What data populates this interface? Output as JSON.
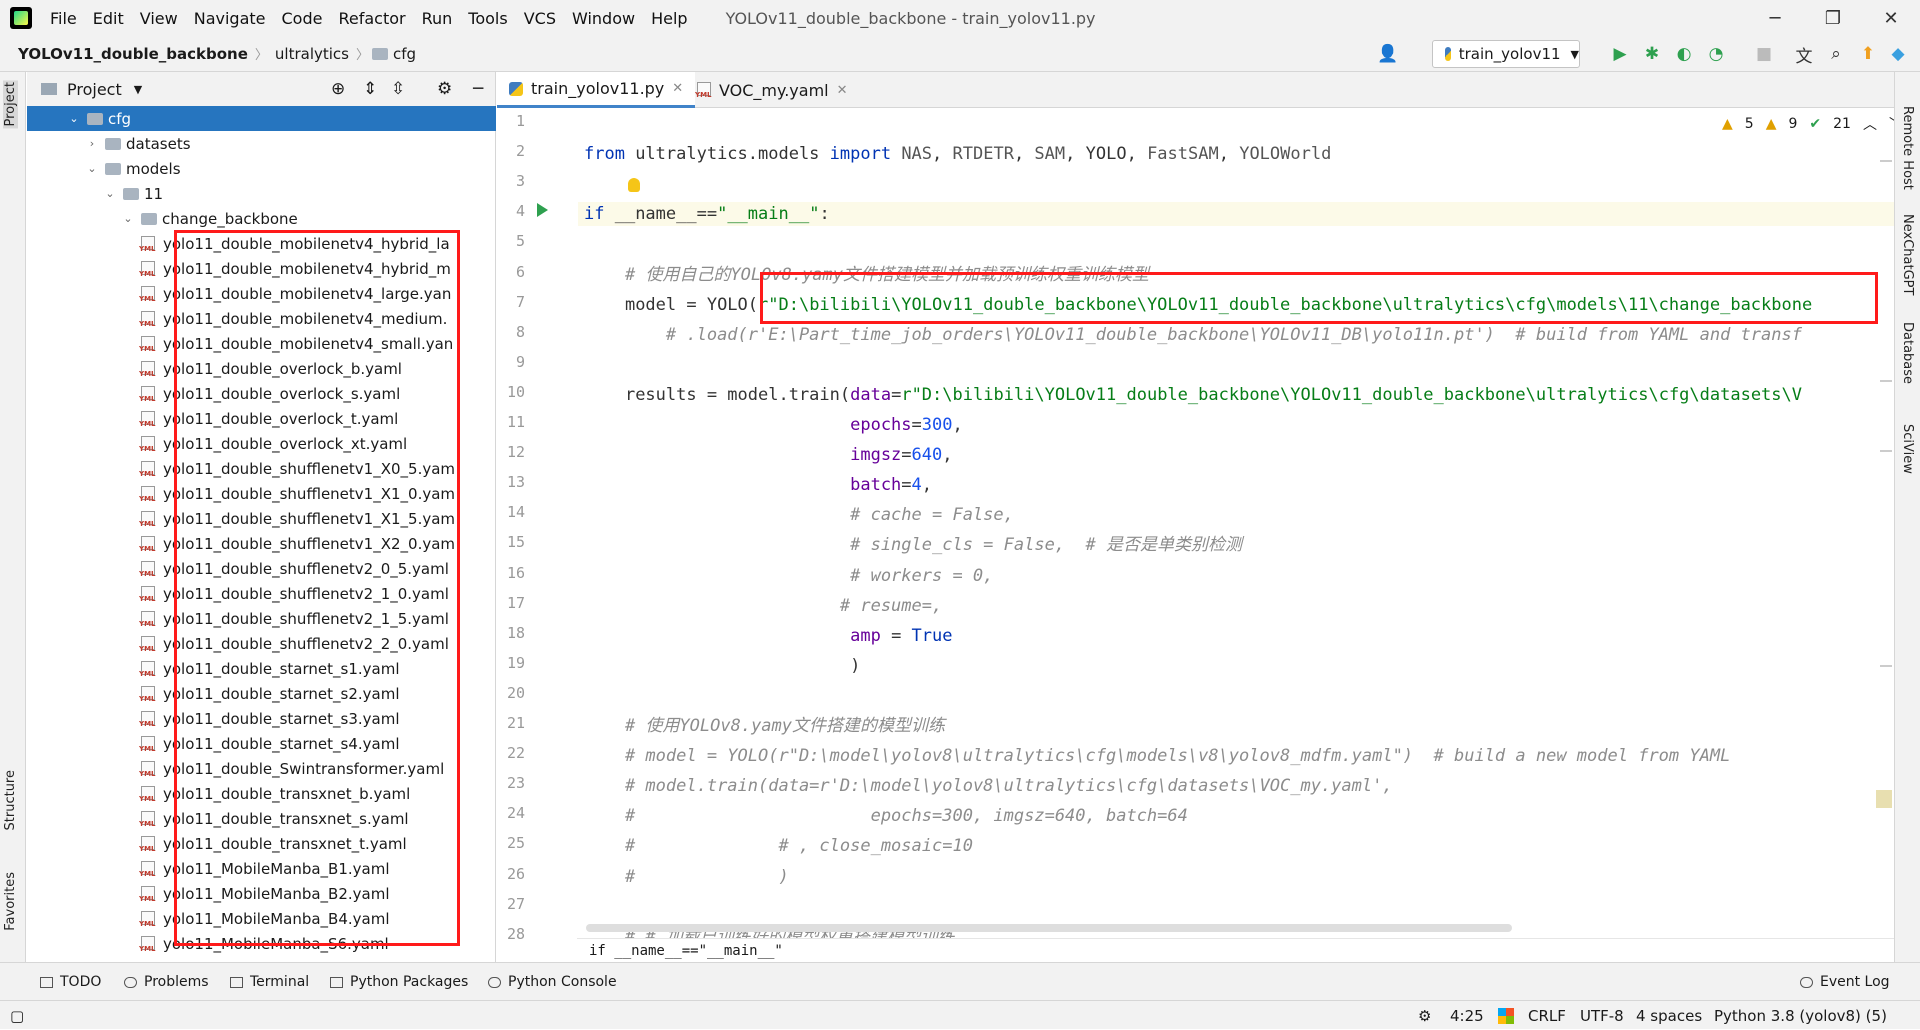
{
  "menubar": {
    "items": [
      "File",
      "Edit",
      "View",
      "Navigate",
      "Code",
      "Refactor",
      "Run",
      "Tools",
      "VCS",
      "Window",
      "Help"
    ],
    "title": "YOLOv11_double_backbone - train_yolov11.py"
  },
  "navbar": {
    "breadcrumb": [
      "YOLOv11_double_backbone",
      "ultralytics",
      "cfg"
    ],
    "run_config": "train_yolov11"
  },
  "project_panel": {
    "title": "Project",
    "tree": [
      {
        "label": "cfg",
        "level": 1,
        "expanded": true,
        "type": "folder",
        "selected": true
      },
      {
        "label": "datasets",
        "level": 2,
        "expanded": false,
        "type": "folder"
      },
      {
        "label": "models",
        "level": 2,
        "expanded": true,
        "type": "folder"
      },
      {
        "label": "11",
        "level": 3,
        "expanded": true,
        "type": "folder"
      },
      {
        "label": "change_backbone",
        "level": 4,
        "expanded": true,
        "type": "folder"
      },
      {
        "label": "yolo11_double_mobilenetv4_hybrid_la",
        "level": 5,
        "type": "yml"
      },
      {
        "label": "yolo11_double_mobilenetv4_hybrid_m",
        "level": 5,
        "type": "yml"
      },
      {
        "label": "yolo11_double_mobilenetv4_large.yan",
        "level": 5,
        "type": "yml"
      },
      {
        "label": "yolo11_double_mobilenetv4_medium.",
        "level": 5,
        "type": "yml"
      },
      {
        "label": "yolo11_double_mobilenetv4_small.yan",
        "level": 5,
        "type": "yml"
      },
      {
        "label": "yolo11_double_overlock_b.yaml",
        "level": 5,
        "type": "yml"
      },
      {
        "label": "yolo11_double_overlock_s.yaml",
        "level": 5,
        "type": "yml"
      },
      {
        "label": "yolo11_double_overlock_t.yaml",
        "level": 5,
        "type": "yml"
      },
      {
        "label": "yolo11_double_overlock_xt.yaml",
        "level": 5,
        "type": "yml"
      },
      {
        "label": "yolo11_double_shufflenetv1_X0_5.yam",
        "level": 5,
        "type": "yml"
      },
      {
        "label": "yolo11_double_shufflenetv1_X1_0.yam",
        "level": 5,
        "type": "yml"
      },
      {
        "label": "yolo11_double_shufflenetv1_X1_5.yam",
        "level": 5,
        "type": "yml"
      },
      {
        "label": "yolo11_double_shufflenetv1_X2_0.yam",
        "level": 5,
        "type": "yml"
      },
      {
        "label": "yolo11_double_shufflenetv2_0_5.yaml",
        "level": 5,
        "type": "yml"
      },
      {
        "label": "yolo11_double_shufflenetv2_1_0.yaml",
        "level": 5,
        "type": "yml"
      },
      {
        "label": "yolo11_double_shufflenetv2_1_5.yaml",
        "level": 5,
        "type": "yml"
      },
      {
        "label": "yolo11_double_shufflenetv2_2_0.yaml",
        "level": 5,
        "type": "yml"
      },
      {
        "label": "yolo11_double_starnet_s1.yaml",
        "level": 5,
        "type": "yml"
      },
      {
        "label": "yolo11_double_starnet_s2.yaml",
        "level": 5,
        "type": "yml"
      },
      {
        "label": "yolo11_double_starnet_s3.yaml",
        "level": 5,
        "type": "yml"
      },
      {
        "label": "yolo11_double_starnet_s4.yaml",
        "level": 5,
        "type": "yml"
      },
      {
        "label": "yolo11_double_Swintransformer.yaml",
        "level": 5,
        "type": "yml"
      },
      {
        "label": "yolo11_double_transxnet_b.yaml",
        "level": 5,
        "type": "yml"
      },
      {
        "label": "yolo11_double_transxnet_s.yaml",
        "level": 5,
        "type": "yml"
      },
      {
        "label": "yolo11_double_transxnet_t.yaml",
        "level": 5,
        "type": "yml"
      },
      {
        "label": "yolo11_MobileManba_B1.yaml",
        "level": 5,
        "type": "yml"
      },
      {
        "label": "yolo11_MobileManba_B2.yaml",
        "level": 5,
        "type": "yml"
      },
      {
        "label": "yolo11_MobileManba_B4.yaml",
        "level": 5,
        "type": "yml"
      },
      {
        "label": "yolo11_MobileManba_S6.yaml",
        "level": 5,
        "type": "yml"
      }
    ]
  },
  "tabs": [
    {
      "label": "train_yolov11.py",
      "active": true,
      "icon": "python-file-icon"
    },
    {
      "label": "VOC_my.yaml",
      "active": false,
      "icon": "yaml-file-icon"
    }
  ],
  "inspections": {
    "warnings": "5",
    "weak_warnings": "9",
    "typos": "21"
  },
  "editor": {
    "line_numbers": [
      "1",
      "2",
      "3",
      "4",
      "5",
      "6",
      "7",
      "8",
      "9",
      "10",
      "11",
      "12",
      "13",
      "14",
      "15",
      "16",
      "17",
      "18",
      "19",
      "20",
      "21",
      "22",
      "23",
      "24",
      "25",
      "26",
      "27",
      "28"
    ],
    "lines": [
      {
        "n": 2,
        "indent": "",
        "parts": [
          {
            "t": "from ",
            "c": "kw"
          },
          {
            "t": "ultralytics.models ",
            "c": "mod"
          },
          {
            "t": "import ",
            "c": "kw"
          },
          {
            "t": "NAS",
            "c": "imp"
          },
          {
            "t": ", ",
            "c": "mod"
          },
          {
            "t": "RTDETR",
            "c": "imp"
          },
          {
            "t": ", ",
            "c": "mod"
          },
          {
            "t": "SAM",
            "c": "imp"
          },
          {
            "t": ", ",
            "c": "mod"
          },
          {
            "t": "YOLO",
            "c": "mod"
          },
          {
            "t": ", ",
            "c": "mod"
          },
          {
            "t": "FastSAM",
            "c": "imp"
          },
          {
            "t": ", ",
            "c": "mod"
          },
          {
            "t": "YOLOWorld",
            "c": "imp"
          }
        ]
      },
      {
        "n": 4,
        "indent": "",
        "hl": true,
        "parts": [
          {
            "t": "if ",
            "c": "kw"
          },
          {
            "t": "__name__==",
            "c": "mod"
          },
          {
            "t": "\"__main__\"",
            "c": "str"
          },
          {
            "t": ":",
            "c": "mod"
          }
        ]
      },
      {
        "n": 6,
        "indent": "    ",
        "parts": [
          {
            "t": "# 使用自己的YOLOv8.yamy文件搭建模型并加载预训练权重训练模型",
            "c": "cm"
          }
        ]
      },
      {
        "n": 7,
        "indent": "    ",
        "parts": [
          {
            "t": "model = YOLO(",
            "c": "mod"
          },
          {
            "t": "r\"D:\\bilibili\\YOLOv11_double_backbone\\YOLOv11_double_backbone\\ultralytics\\cfg\\models\\11\\change_backbone",
            "c": "str"
          }
        ]
      },
      {
        "n": 8,
        "indent": "        ",
        "parts": [
          {
            "t": "# .load(r'E:\\Part_time_job_orders\\YOLOv11_double_backbone\\YOLOv11_DB\\yolo11n.pt')  # build from YAML and transf",
            "c": "cm"
          }
        ]
      },
      {
        "n": 10,
        "indent": "    ",
        "parts": [
          {
            "t": "results = model.train(",
            "c": "mod"
          },
          {
            "t": "data",
            "c": "kwa"
          },
          {
            "t": "=",
            "c": "mod"
          },
          {
            "t": "r\"D:\\bilibili\\YOLOv11_double_backbone\\YOLOv11_double_backbone\\ultralytics\\cfg\\datasets\\V",
            "c": "str"
          }
        ]
      },
      {
        "n": 11,
        "indent": "                          ",
        "parts": [
          {
            "t": "epochs",
            "c": "kwa"
          },
          {
            "t": "=",
            "c": "mod"
          },
          {
            "t": "300",
            "c": "num"
          },
          {
            "t": ",",
            "c": "mod"
          }
        ]
      },
      {
        "n": 12,
        "indent": "                          ",
        "parts": [
          {
            "t": "imgsz",
            "c": "kwa"
          },
          {
            "t": "=",
            "c": "mod"
          },
          {
            "t": "640",
            "c": "num"
          },
          {
            "t": ",",
            "c": "mod"
          }
        ]
      },
      {
        "n": 13,
        "indent": "                          ",
        "parts": [
          {
            "t": "batch",
            "c": "kwa"
          },
          {
            "t": "=",
            "c": "mod"
          },
          {
            "t": "4",
            "c": "num"
          },
          {
            "t": ",",
            "c": "mod"
          }
        ]
      },
      {
        "n": 14,
        "indent": "                          ",
        "parts": [
          {
            "t": "# cache = False,",
            "c": "cm"
          }
        ]
      },
      {
        "n": 15,
        "indent": "                          ",
        "parts": [
          {
            "t": "# single_cls = False,  # 是否是单类别检测",
            "c": "cm"
          }
        ]
      },
      {
        "n": 16,
        "indent": "                          ",
        "parts": [
          {
            "t": "# workers = 0,",
            "c": "cm"
          }
        ]
      },
      {
        "n": 17,
        "indent": "                         ",
        "parts": [
          {
            "t": "# resume=,",
            "c": "cm"
          }
        ]
      },
      {
        "n": 18,
        "indent": "                          ",
        "parts": [
          {
            "t": "amp",
            "c": "kwa"
          },
          {
            "t": " = ",
            "c": "mod"
          },
          {
            "t": "True",
            "c": "kw"
          }
        ]
      },
      {
        "n": 19,
        "indent": "                          ",
        "parts": [
          {
            "t": ")",
            "c": "mod"
          }
        ]
      },
      {
        "n": 21,
        "indent": "    ",
        "parts": [
          {
            "t": "# 使用YOLOv8.yamy文件搭建的模型训练",
            "c": "cm"
          }
        ]
      },
      {
        "n": 22,
        "indent": "    ",
        "parts": [
          {
            "t": "# model = YOLO(r\"D:\\model\\yolov8\\ultralytics\\cfg\\models\\v8\\yolov8_mdfm.yaml\")  # build a new model from YAML",
            "c": "cm"
          }
        ]
      },
      {
        "n": 23,
        "indent": "    ",
        "parts": [
          {
            "t": "# model.train(data=r'D:\\model\\yolov8\\ultralytics\\cfg\\datasets\\VOC_my.yaml',",
            "c": "cm"
          }
        ]
      },
      {
        "n": 24,
        "indent": "    ",
        "parts": [
          {
            "t": "#                       epochs=300, imgsz=640, batch=64",
            "c": "cm"
          }
        ]
      },
      {
        "n": 25,
        "indent": "    ",
        "parts": [
          {
            "t": "#              # , close_mosaic=10",
            "c": "cm"
          }
        ]
      },
      {
        "n": 26,
        "indent": "    ",
        "parts": [
          {
            "t": "#              )",
            "c": "cm"
          }
        ]
      },
      {
        "n": 28,
        "indent": "    ",
        "parts": [
          {
            "t": "# # 加载已训练好的模型权重搭建模型训练",
            "c": "cm"
          }
        ]
      }
    ],
    "breadcrumb": "if __name__==\"__main__\""
  },
  "left_strip": [
    "Project",
    "Structure",
    "Favorites"
  ],
  "right_strip": [
    "Remote Host",
    "NexChatGPT",
    "Database",
    "SciView"
  ],
  "tool_windows": [
    "TODO",
    "Problems",
    "Terminal",
    "Python Packages",
    "Python Console"
  ],
  "event_log": "Event Log",
  "status": {
    "position": "4:25",
    "line_sep": "CRLF",
    "encoding": "UTF-8",
    "indent": "4 spaces",
    "interpreter": "Python 3.8 (yolov8) (5)"
  },
  "colors": {
    "selection": "#2675bf",
    "highlight_box": "#ff1a1a",
    "keyword": "#0033b3",
    "string": "#067d17"
  }
}
